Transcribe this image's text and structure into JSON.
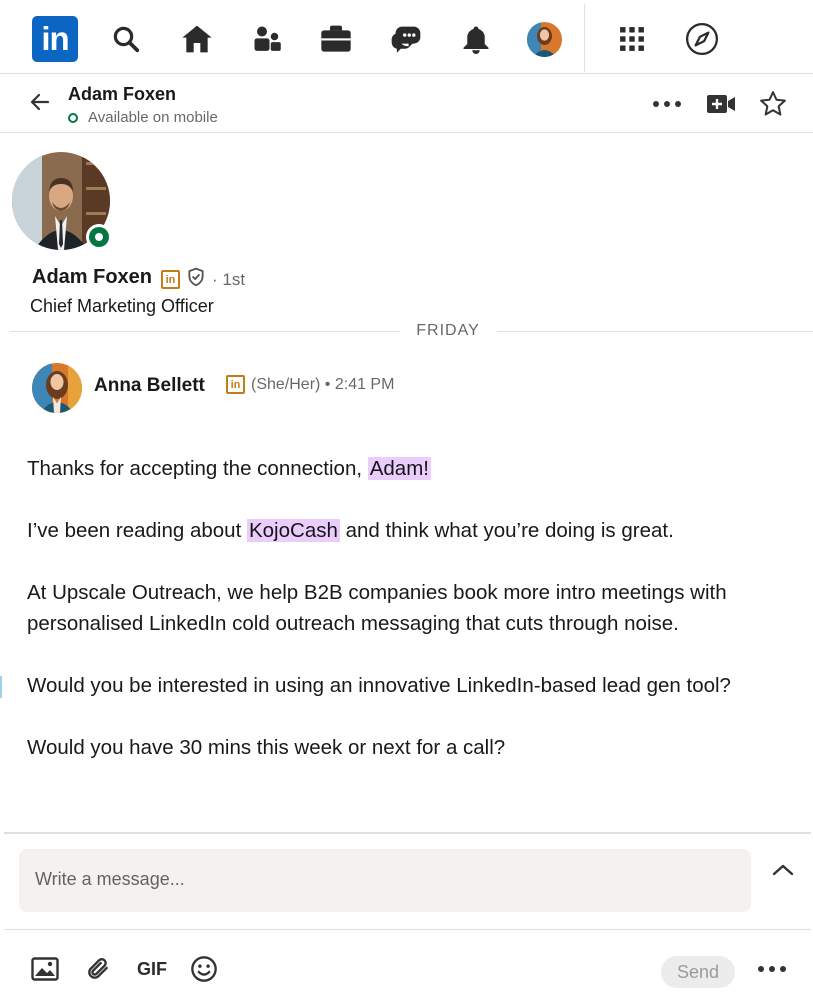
{
  "nav": {
    "logo_text": "in",
    "icons": [
      "search-icon",
      "home-icon",
      "network-icon",
      "jobs-icon",
      "messaging-icon",
      "notifications-icon",
      "me-avatar",
      "apps-grid-icon",
      "explore-icon"
    ]
  },
  "header": {
    "name": "Adam Foxen",
    "status": "Available on mobile"
  },
  "profile": {
    "name": "Adam Foxen",
    "badge_text": "in",
    "degree": "· 1st",
    "headline": "Chief Marketing Officer"
  },
  "divider": {
    "label": "FRIDAY"
  },
  "message": {
    "sender": "Anna Bellett",
    "badge_text": "in",
    "meta": "(She/Her) • 2:41 PM",
    "p1_before": "Thanks for accepting the connection, ",
    "p1_highlight": "Adam!",
    "p2_before": "I’ve been reading about ",
    "p2_highlight": "KojoCash",
    "p2_after": " and think what you’re doing is great.",
    "p3": "At Upscale Outreach, we help B2B companies book more intro meetings with personalised LinkedIn cold outreach messaging that cuts through noise.",
    "p4": "Would you be interested in using an innovative LinkedIn-based lead gen tool?",
    "p5": "Would you have 30 mins this week or next for a call?"
  },
  "composer": {
    "placeholder": "Write a message...",
    "gif_label": "GIF",
    "send_label": "Send"
  },
  "colors": {
    "brand": "#0a66c2",
    "online": "#057642",
    "highlight": "#ebcdfc",
    "premium_badge": "#c37d16"
  }
}
